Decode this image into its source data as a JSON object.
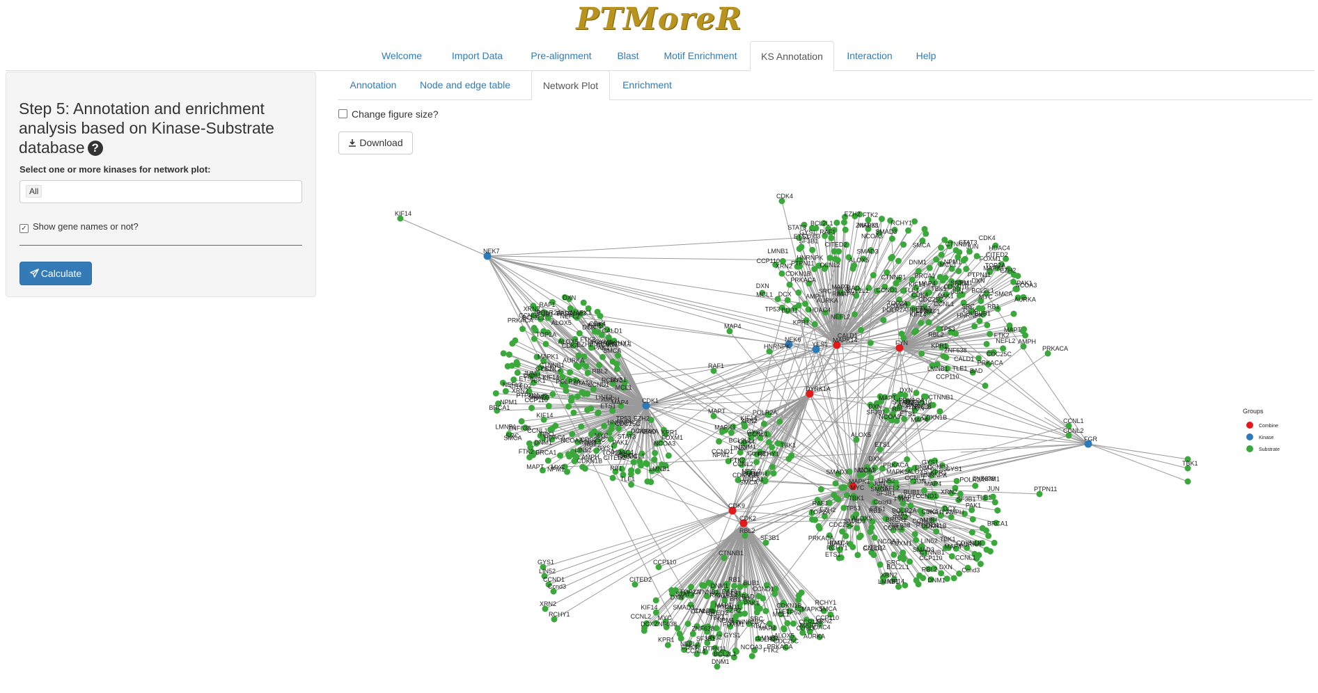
{
  "app": {
    "logo": "PTMoreR"
  },
  "nav": {
    "tabs": [
      {
        "label": "Welcome"
      },
      {
        "label": "Import Data"
      },
      {
        "label": "Pre-alignment"
      },
      {
        "label": "Blast"
      },
      {
        "label": "Motif Enrichment"
      },
      {
        "label": "KS Annotation",
        "active": true
      },
      {
        "label": "Interaction"
      },
      {
        "label": "Help"
      }
    ]
  },
  "sidebar": {
    "title": "Step 5: Annotation and enrichment analysis based on Kinase-Substrate database",
    "select_label": "Select one or more kinases for network plot:",
    "select_value": "All",
    "show_names_label": "Show gene names or not?",
    "show_names_checked": true,
    "calculate_label": "Calculate"
  },
  "subtabs": [
    {
      "label": "Annotation"
    },
    {
      "label": "Node and edge table"
    },
    {
      "label": "Network Plot",
      "active": true
    },
    {
      "label": "Enrichment"
    }
  ],
  "plot_panel": {
    "change_size_label": "Change figure size?",
    "download_label": "Download"
  },
  "legend": {
    "title": "Groups",
    "items": [
      {
        "label": "Combine",
        "color": "#e31a1c"
      },
      {
        "label": "Kinase",
        "color": "#2b7bba"
      },
      {
        "label": "Substrate",
        "color": "#3aa83a"
      }
    ]
  },
  "network": {
    "edge_color": "#9a9a9a",
    "hubs": [
      {
        "label": "CDK1",
        "group": "Kinase"
      },
      {
        "label": "MAPK14",
        "group": "Combine"
      },
      {
        "label": "FYN",
        "group": "Combine"
      },
      {
        "label": "MAPK1",
        "group": "Combine"
      },
      {
        "label": "CDK2",
        "group": "Combine"
      },
      {
        "label": "CDK9",
        "group": "Combine"
      },
      {
        "label": "DYRK1A",
        "group": "Combine"
      },
      {
        "label": "NEK6",
        "group": "Kinase"
      },
      {
        "label": "YES1",
        "group": "Kinase"
      },
      {
        "label": "NEK7",
        "group": "Kinase"
      },
      {
        "label": "FGR",
        "group": "Kinase"
      }
    ],
    "outer_labels": [
      "KIF14",
      "CDK4",
      "FTK2",
      "BCL2L1",
      "MAPK1",
      "SMCA",
      "NEFL2",
      "NPM1",
      "BRCA1",
      "POLR2A",
      "AMPH",
      "CCNL1",
      "CCNL2",
      "TBK1",
      "GYS1",
      "LIN52",
      "CCND1",
      "Ccnd3",
      "XRN2",
      "RCHY1",
      "DNM1",
      "ETS1",
      "ALOX5",
      "SMAD3",
      "JUN",
      "RBL2",
      "SF3B1",
      "CDKN1B",
      "MAP4",
      "DXN",
      "PRKACA",
      "RAF1",
      "MAPT",
      "PTPN11",
      "CTNNB1",
      "CCP110",
      "ZNF638",
      "NCOA3",
      "CITED2",
      "HNRNPK",
      "KPR1",
      "DCX",
      "STAT3",
      "RB1",
      "TP53",
      "BAD",
      "TLE1",
      "HDAC4",
      "CALD1",
      "MCL1",
      "MYC",
      "SRC",
      "TOP2A",
      "EZH2",
      "CDC25C",
      "LMNB1",
      "FOXM1",
      "PAK1",
      "AURKA",
      "BUB1"
    ]
  }
}
